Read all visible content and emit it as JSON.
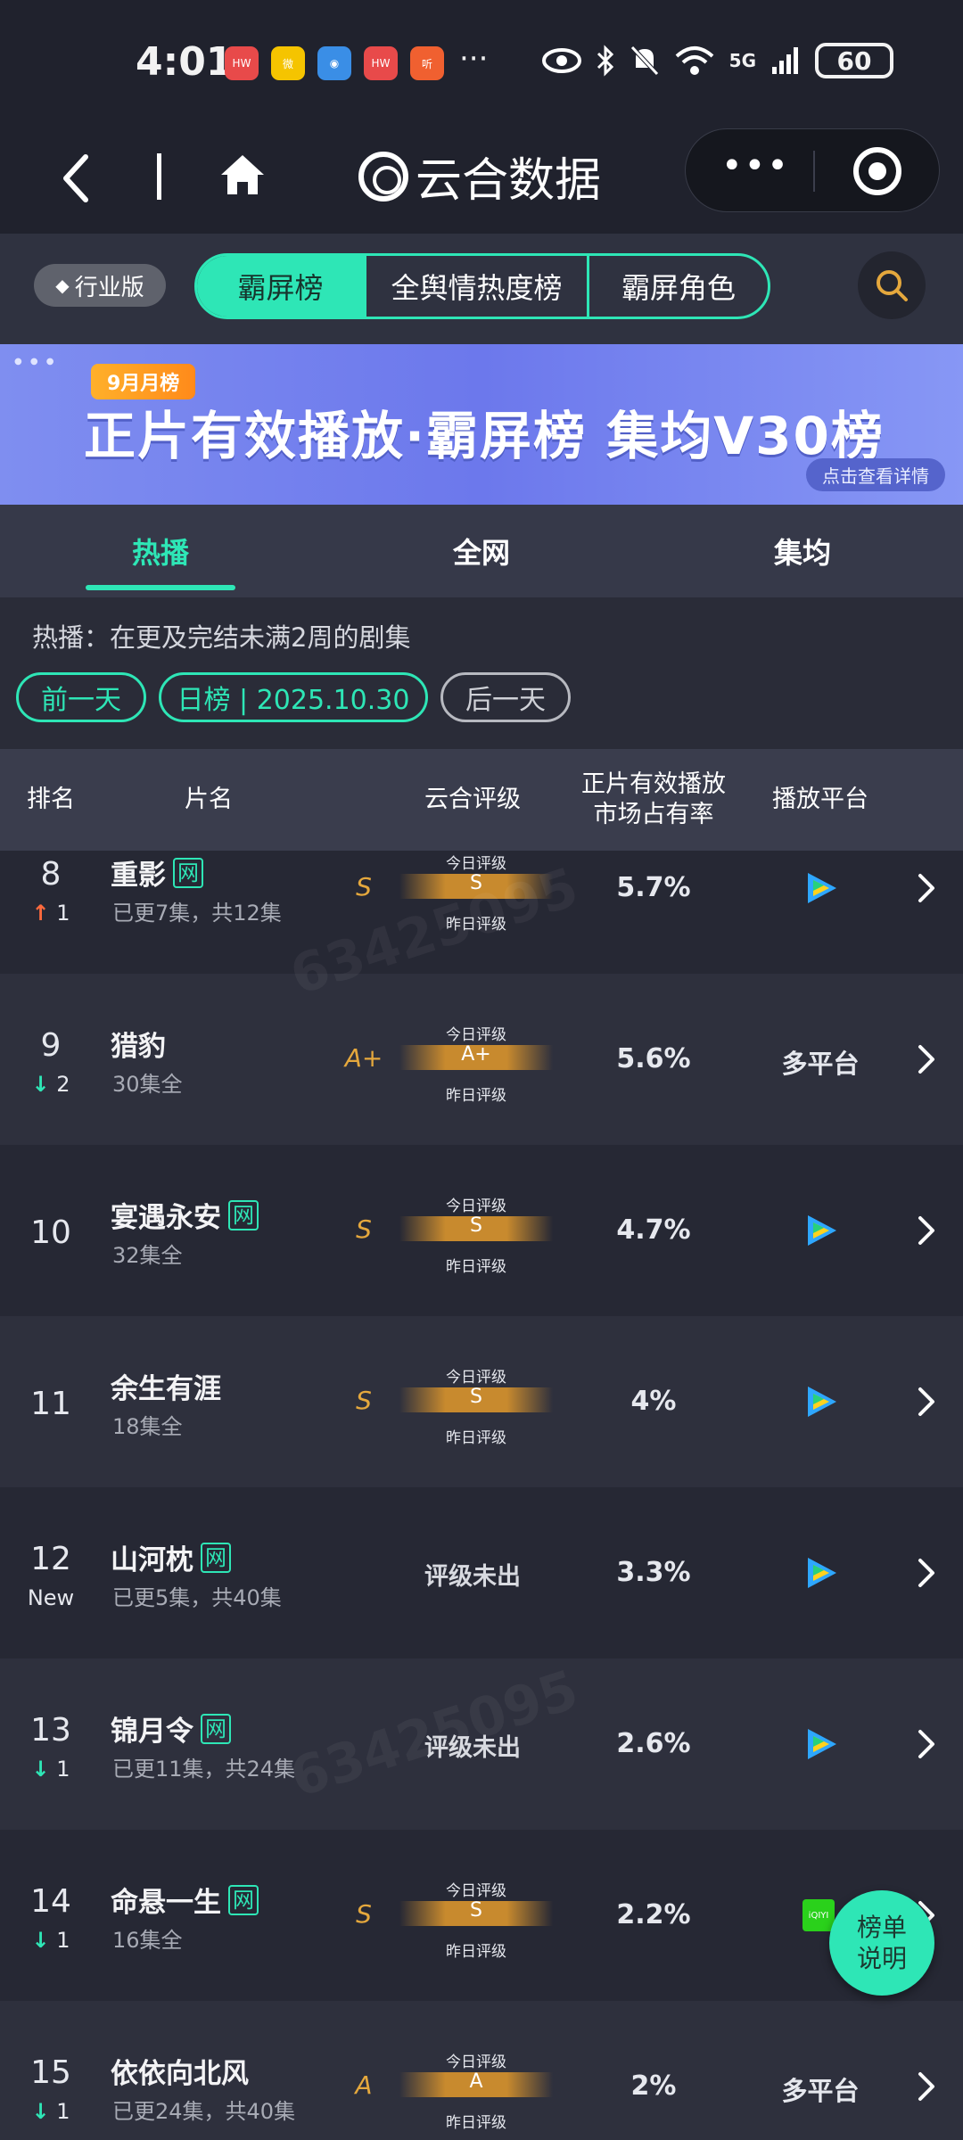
{
  "status_bar": {
    "time": "4:01",
    "app_icons": [
      "huawei-icon",
      "weibo-icon",
      "browser-icon",
      "huawei-icon",
      "ting-icon"
    ],
    "more": "···",
    "network": "5G",
    "battery": "60"
  },
  "title_bar": {
    "app_name": "云合数据",
    "capsule_more": "•••"
  },
  "nav": {
    "edition_label": "行业版",
    "segments": [
      "霸屏榜",
      "全舆情热度榜",
      "霸屏角色"
    ],
    "active_segment": 0
  },
  "banner": {
    "tag": "9月月榜",
    "title": "正片有效播放·霸屏榜 集均V30榜",
    "link": "点击查看详情"
  },
  "subtabs": [
    "热播",
    "全网",
    "集均"
  ],
  "info": {
    "description": "热播：在更及完结未满2周的剧集",
    "prev_day": "前一天",
    "date_label": "日榜 | 2025.10.30",
    "next_day": "后一天"
  },
  "table": {
    "headers": {
      "rank": "排名",
      "title": "片名",
      "rating": "云合评级",
      "share_line1": "正片有效播放",
      "share_line2": "市场占有率",
      "platform": "播放平台"
    },
    "grade_today_label": "今日评级",
    "grade_yesterday_label": "昨日评级",
    "no_grade_text": "评级未出",
    "rows": [
      {
        "rank": "8",
        "change_dir": "up",
        "change": "1",
        "name": "重影",
        "network_tag": "网",
        "episodes": "已更7集，共12集",
        "grade": "S",
        "bar_grade": "S",
        "share": "5.7%",
        "platform": "tencent"
      },
      {
        "rank": "9",
        "change_dir": "down",
        "change": "2",
        "name": "猎豹",
        "network_tag": "",
        "episodes": "30集全",
        "grade": "A+",
        "bar_grade": "A+",
        "share": "5.6%",
        "platform_text": "多平台"
      },
      {
        "rank": "10",
        "change_dir": "",
        "change": "",
        "name": "宴遇永安",
        "network_tag": "网",
        "episodes": "32集全",
        "grade": "S",
        "bar_grade": "S",
        "share": "4.7%",
        "platform": "tencent"
      },
      {
        "rank": "11",
        "change_dir": "",
        "change": "",
        "name": "余生有涯",
        "network_tag": "",
        "episodes": "18集全",
        "grade": "S",
        "bar_grade": "S",
        "share": "4%",
        "platform": "tencent"
      },
      {
        "rank": "12",
        "change_dir": "new",
        "change": "New",
        "name": "山河枕",
        "network_tag": "网",
        "episodes": "已更5集，共40集",
        "grade": "",
        "bar_grade": "",
        "share": "3.3%",
        "platform": "tencent"
      },
      {
        "rank": "13",
        "change_dir": "down",
        "change": "1",
        "name": "锦月令",
        "network_tag": "网",
        "episodes": "已更11集，共24集",
        "grade": "",
        "bar_grade": "",
        "share": "2.6%",
        "platform": "tencent"
      },
      {
        "rank": "14",
        "change_dir": "down",
        "change": "1",
        "name": "命悬一生",
        "network_tag": "网",
        "episodes": "16集全",
        "grade": "S",
        "bar_grade": "S",
        "share": "2.2%",
        "platform": "iqiyi"
      },
      {
        "rank": "15",
        "change_dir": "down",
        "change": "1",
        "name": "依依向北风",
        "network_tag": "",
        "episodes": "已更24集，共40集",
        "grade": "A",
        "bar_grade": "A",
        "share": "2%",
        "platform_text": "多平台"
      }
    ]
  },
  "fab_label_line1": "榜单",
  "fab_label_line2": "说明",
  "watermark": "63425095",
  "colors": {
    "accent": "#2ee6b6",
    "background": "#20222d",
    "grade": "#e5a83d",
    "rank_up": "#ff6a3d"
  }
}
